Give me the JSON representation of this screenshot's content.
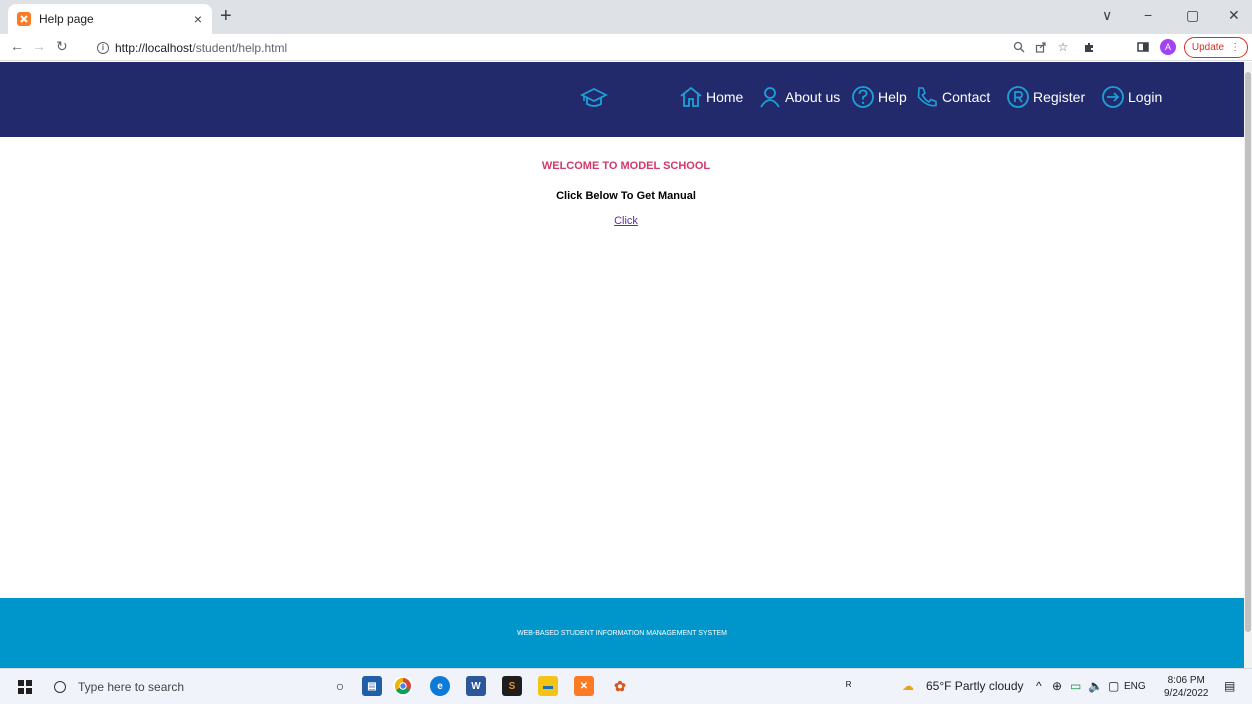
{
  "browser": {
    "tab_title": "Help page",
    "tab_close": "×",
    "new_tab": "+",
    "url_host": "http://localhost",
    "url_path": "/student/help.html",
    "profile_initial": "A",
    "update_label": "Update",
    "window_controls": [
      "∨",
      "−",
      "▢",
      "✕"
    ]
  },
  "header": {
    "nav": [
      {
        "label": "Home",
        "icon": "home-icon"
      },
      {
        "label": "About us",
        "icon": "user-icon"
      },
      {
        "label": "Help",
        "icon": "help-icon"
      },
      {
        "label": "Contact",
        "icon": "phone-icon"
      },
      {
        "label": "Register",
        "icon": "registered-icon"
      },
      {
        "label": "Login",
        "icon": "login-icon"
      }
    ],
    "logo_icon": "graduation-cap-icon",
    "colors": {
      "header_bg": "#222a6b",
      "icon_blue": "#1ca0d8",
      "footer_bg": "#0096cc"
    }
  },
  "content": {
    "welcome": "WELCOME TO MODEL SCHOOL",
    "manual_text": "Click Below To Get Manual",
    "link_text": "Click"
  },
  "footer": {
    "text": "WEB-BASED STUDENT INFORMATION MANAGEMENT SYSTEM"
  },
  "taskbar": {
    "search_placeholder": "Type here to search",
    "weather": "65°F  Partly cloudy",
    "language": "ENG",
    "time": "8:06 PM",
    "date": "9/24/2022"
  }
}
